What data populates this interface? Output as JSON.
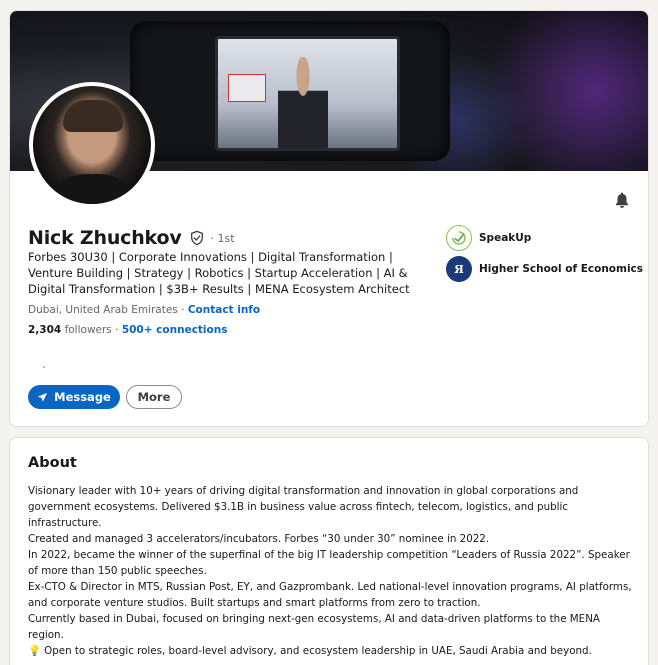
{
  "profile": {
    "name": "Nick Zhuchkov",
    "degree": "· 1st",
    "headline": "Forbes 30U30 | Corporate Innovations | Digital Transformation | Venture Building | Strategy | Robotics | Startup Acceleration | AI & Digital Transformation | $3B+ Results | MENA Ecosystem Architect",
    "location": "Dubai, United Arab Emirates",
    "location_separator": "·",
    "contact_info": "Contact info",
    "followers_count": "2,304",
    "followers_label": "followers",
    "connections_separator": "·",
    "connections": "500+ connections"
  },
  "actions": {
    "message_label": "Message",
    "more_label": "More"
  },
  "organizations": [
    {
      "name": "SpeakUp",
      "icon": "speakup-logo"
    },
    {
      "name": "Higher School of Economics",
      "icon": "hse-logo"
    }
  ],
  "hse_logo_letter": "Я",
  "about": {
    "title": "About",
    "text": "Visionary leader with 10+ years of driving digital transformation and innovation in global corporations and government ecosystems. Delivered $3.1B in business value across fintech, telecom, logistics, and public infrastructure.\nCreated and managed 3 accelerators/incubators. Forbes “30 under 30” nominee in 2022.\nIn 2022, became the winner of the superfinal of the big IT leadership competition “Leaders of Russia 2022”. Speaker of more than 150 public speeches.\nEx-CTO & Director in MTS, Russian Post, EY, and Gazprombank. Led national-level innovation programs, AI platforms, and corporate venture studios. Built startups and smart platforms from zero to traction.\nCurrently based in Dubai, focused on bringing next-gen ecosystems, AI and data-driven platforms to the MENA region.\n💡 Open to strategic roles, board-level advisory, and ecosystem leadership in UAE, Saudi Arabia and beyond.\n\nLet’s connect if you’re building the future of digital."
  },
  "colors": {
    "accent": "#0a66c2",
    "background": "#f4f2ee",
    "card": "#ffffff"
  },
  "icons": [
    "notification-bell-icon",
    "verified-shield-icon",
    "send-icon"
  ]
}
